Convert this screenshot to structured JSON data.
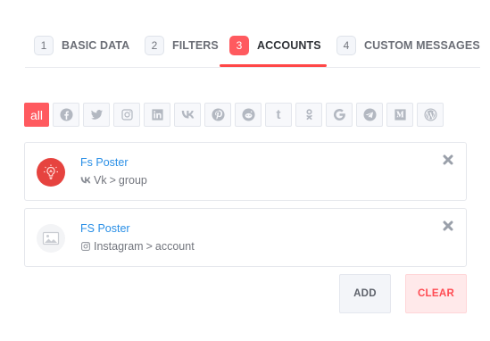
{
  "tabs": [
    {
      "number": "1",
      "label": "BASIC DATA"
    },
    {
      "number": "2",
      "label": "FILTERS"
    },
    {
      "number": "3",
      "label": "ACCOUNTS"
    },
    {
      "number": "4",
      "label": "CUSTOM MESSAGES"
    }
  ],
  "active_tab": "ACCOUNTS",
  "filters": {
    "all_label": "all",
    "networks": [
      "facebook",
      "twitter",
      "instagram",
      "linkedin",
      "vk",
      "pinterest",
      "reddit",
      "tumblr",
      "odnoklassniki",
      "google",
      "telegram",
      "medium",
      "wordpress"
    ]
  },
  "accounts": [
    {
      "name": "Fs Poster",
      "network": "Vk",
      "separator": ">",
      "type": "group",
      "network_icon": "vk-icon",
      "avatar": "lightbulb-avatar"
    },
    {
      "name": "FS Poster",
      "network": "Instagram",
      "separator": ">",
      "type": "account",
      "network_icon": "instagram-icon",
      "avatar": "placeholder-image-avatar"
    }
  ],
  "buttons": {
    "add": "ADD",
    "clear": "CLEAR"
  },
  "colors": {
    "accent": "#ff5a5f",
    "link": "#2a8fe6",
    "clear_text": "#ff4b52"
  }
}
